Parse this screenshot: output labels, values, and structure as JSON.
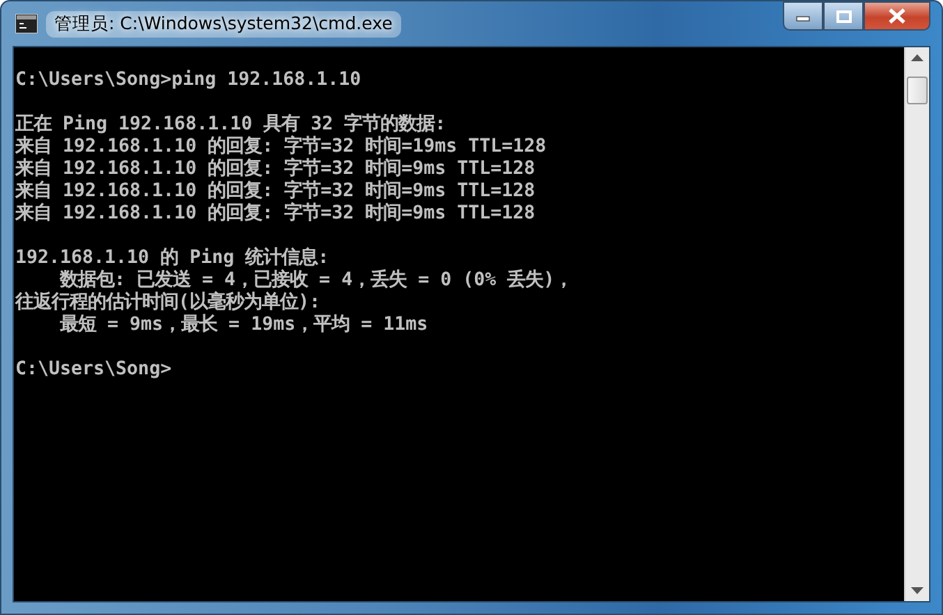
{
  "window": {
    "title": "管理员: C:\\Windows\\system32\\cmd.exe"
  },
  "console": {
    "blocks": [
      {
        "lines": [
          "C:\\Users\\Song>ping 192.168.1.10"
        ]
      },
      {
        "lines": [
          "正在 Ping 192.168.1.10 具有 32 字节的数据:",
          "来自 192.168.1.10 的回复: 字节=32 时间=19ms TTL=128",
          "来自 192.168.1.10 的回复: 字节=32 时间=9ms TTL=128",
          "来自 192.168.1.10 的回复: 字节=32 时间=9ms TTL=128",
          "来自 192.168.1.10 的回复: 字节=32 时间=9ms TTL=128"
        ]
      },
      {
        "lines": [
          "192.168.1.10 的 Ping 统计信息:",
          "    数据包: 已发送 = 4，已接收 = 4，丢失 = 0 (0% 丢失)，",
          "往返行程的估计时间(以毫秒为单位):",
          "    最短 = 9ms，最长 = 19ms，平均 = 11ms"
        ]
      },
      {
        "lines": [
          "C:\\Users\\Song>"
        ]
      }
    ]
  }
}
